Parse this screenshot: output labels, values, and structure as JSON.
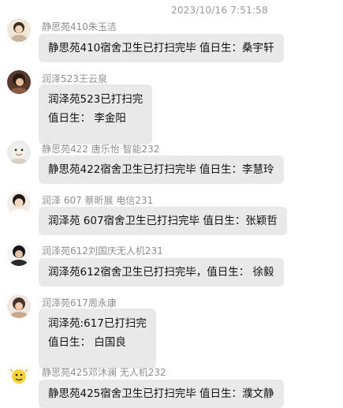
{
  "timestamp": "2023/10/16 7:51:58",
  "messages": [
    {
      "sender": "静思苑410朱玉洁",
      "lines": [
        "静思苑410宿舍卫生已打扫完毕  值日生：桑宇轩"
      ]
    },
    {
      "sender": "润泽523王云泉",
      "lines": [
        "润泽苑523已打扫完",
        "值日生：  李金阳"
      ]
    },
    {
      "sender": "静思苑422 唐乐怡 智能232",
      "lines": [
        "静思苑422宿舍卫生已打扫完毕  值日生：李慧玲"
      ]
    },
    {
      "sender": "润泽 607 蔡昕展 电信231",
      "lines": [
        "润泽苑 607宿舍卫生已打扫完毕  值日生：张颖哲"
      ]
    },
    {
      "sender": "润泽苑612刘国庆无人机231",
      "lines": [
        "润泽苑612宿舍卫生已打扫完毕，值日生：  徐毅"
      ]
    },
    {
      "sender": "润泽苑617周永康",
      "lines": [
        "润泽苑:617已打扫完",
        "值日生：  白国良"
      ]
    },
    {
      "sender": "静思苑425邓沐澜 无人机232",
      "lines": [
        "静思苑425宿舍卫生已打扫完毕  值日生：濮文静"
      ]
    }
  ]
}
